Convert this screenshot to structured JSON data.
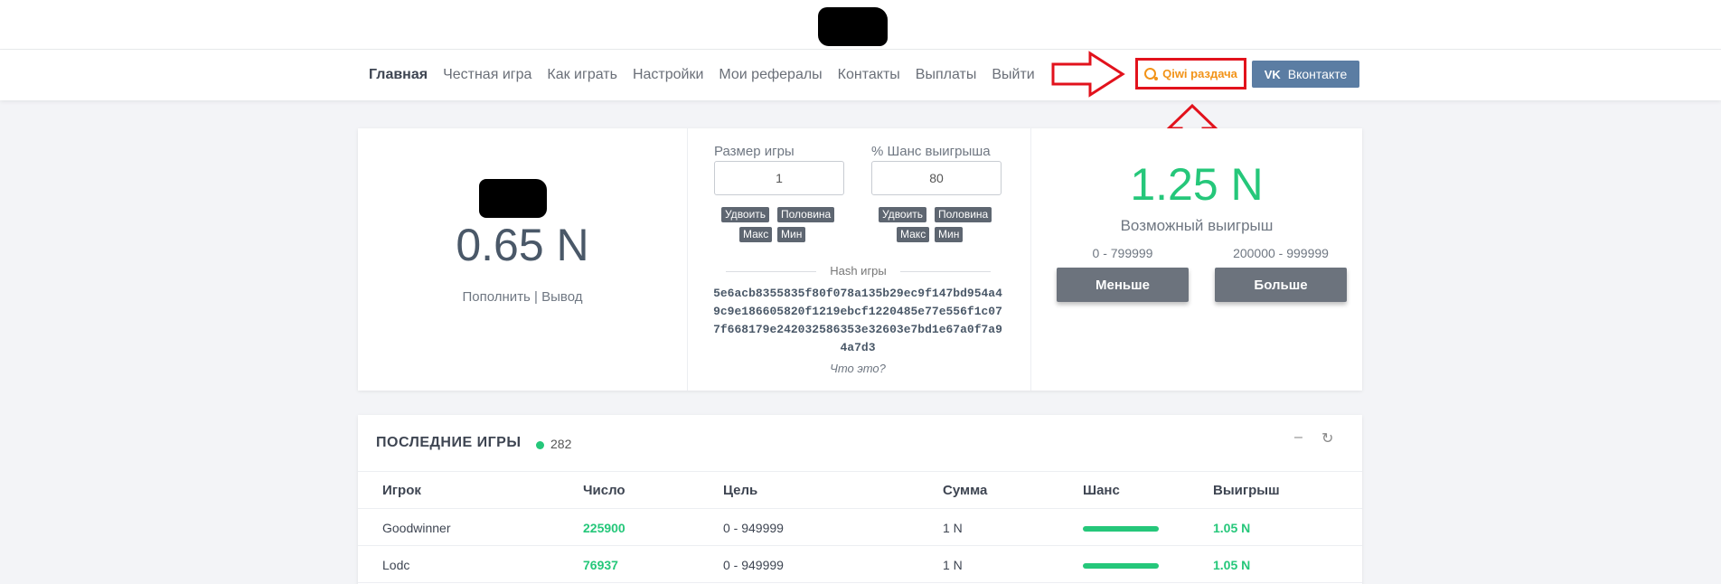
{
  "nav": {
    "items": [
      "Главная",
      "Честная игра",
      "Как играть",
      "Настройки",
      "Мои рефералы",
      "Контакты",
      "Выплаты",
      "Выйти"
    ],
    "active_index": 0,
    "qiwi_label": "Qiwi раздача",
    "vk_logo": "VK",
    "vk_label": "Вконтакте"
  },
  "balance": {
    "amount": "0.65 N",
    "deposit_label": "Пополнить",
    "separator": "|",
    "withdraw_label": "Вывод"
  },
  "game": {
    "size_label": "Размер игры",
    "size_value": "1",
    "chance_label": "% Шанс выигрыша",
    "chance_value": "80",
    "double_label": "Удвоить",
    "half_label": "Половина",
    "max_label": "Макс",
    "min_label": "Мин",
    "hash_title": "Hash игры",
    "hash_value": "5e6acb8355835f80f078a135b29ec9f147bd954a49c9e186605820f1219ebcf1220485e77e556f1c077f668179e242032586353e32603e7bd1e67a0f7a94a7d3",
    "hash_help": "Что это?"
  },
  "payout": {
    "amount": "1.25 N",
    "label": "Возможный выигрыш",
    "low_range": "0 - 799999",
    "high_range": "200000 - 999999",
    "low_button": "Меньше",
    "high_button": "Больше"
  },
  "colors": {
    "accent_green": "#25c77a",
    "highlight_red": "#e2121c",
    "qiwi_orange": "#f29318",
    "vk_blue": "#5b7da3"
  },
  "recent": {
    "title": "ПОСЛЕДНИЕ ИГРЫ",
    "online": "282",
    "minimize_icon": "minus-icon",
    "refresh_icon": "refresh-icon",
    "columns": [
      "Игрок",
      "Число",
      "Цель",
      "Сумма",
      "Шанс",
      "Выигрыш"
    ],
    "rows": [
      {
        "player": "Goodwinner",
        "number": "225900",
        "target": "0 - 949999",
        "amount": "1 N",
        "chance": 0.95,
        "win": "1.05 N"
      },
      {
        "player": "Lodc",
        "number": "76937",
        "target": "0 - 949999",
        "amount": "1 N",
        "chance": 0.95,
        "win": "1.05 N"
      }
    ]
  }
}
